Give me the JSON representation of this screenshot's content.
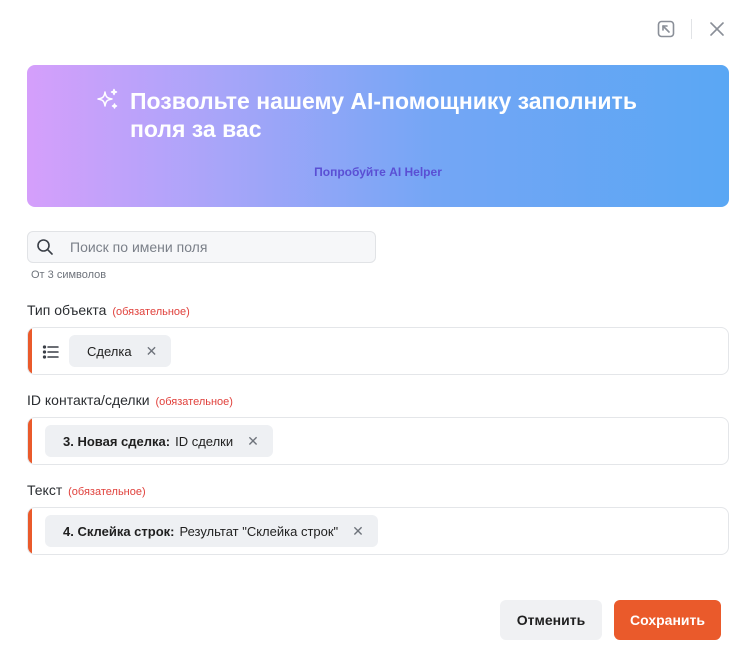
{
  "ai_helper": {
    "title": "Позвольте нашему AI-помощнику заполнить поля за вас",
    "link": "Попробуйте AI Helper"
  },
  "search": {
    "placeholder": "Поиск по имени поля",
    "value": "",
    "hint": "От 3 символов"
  },
  "fields": [
    {
      "label": "Тип объекта",
      "required_label": "(обязательное)",
      "chip": {
        "prefix": "",
        "text": "Сделка"
      }
    },
    {
      "label": "ID контакта/сделки",
      "required_label": "(обязательное)",
      "chip": {
        "prefix": "3. Новая сделка:",
        "text": "ID сделки"
      }
    },
    {
      "label": "Текст",
      "required_label": "(обязательное)",
      "chip": {
        "prefix": "4. Склейка строк:",
        "text": "Результат \"Склейка строк\""
      }
    }
  ],
  "buttons": {
    "cancel": "Отменить",
    "save": "Сохранить"
  },
  "colors": {
    "accent": "#ea5a2b",
    "required": "#e0413c",
    "ai_link": "#5a4fd4"
  },
  "icons": {
    "top_left": "open-external-icon",
    "top_right": "close-icon",
    "banner": "sparkle-icon",
    "search": "search-icon",
    "type_field": "list-icon",
    "chip_remove": "remove-icon"
  }
}
